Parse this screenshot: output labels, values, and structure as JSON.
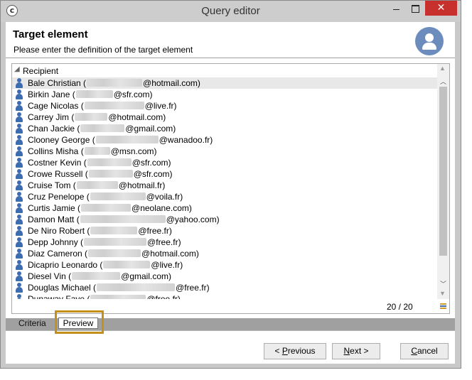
{
  "window": {
    "title": "Query editor",
    "app_icon_glyph": "c",
    "close_glyph": "✕"
  },
  "header": {
    "title": "Target element",
    "subtitle": "Please enter the definition of the target element"
  },
  "list": {
    "column_label": "Recipient",
    "rows": [
      {
        "name": "Bale Christian (",
        "email": "@hotmail.com)",
        "selected": true
      },
      {
        "name": "Birkin Jane (",
        "email": "@sfr.com)"
      },
      {
        "name": "Cage Nicolas (",
        "email": "@live.fr)"
      },
      {
        "name": "Carrey Jim (",
        "email": "@hotmail.com)"
      },
      {
        "name": "Chan Jackie (",
        "email": "@gmail.com)"
      },
      {
        "name": "Clooney George (",
        "email": "@wanadoo.fr)"
      },
      {
        "name": "Collins Misha (",
        "email": "@msn.com)"
      },
      {
        "name": "Costner Kevin (",
        "email": "@sfr.com)"
      },
      {
        "name": "Crowe Russell (",
        "email": "@sfr.com)"
      },
      {
        "name": "Cruise Tom (",
        "email": "@hotmail.fr)"
      },
      {
        "name": "Cruz Penelope (",
        "email": "@voila.fr)"
      },
      {
        "name": "Curtis Jamie (",
        "email": "@neolane.com)"
      },
      {
        "name": "Damon Matt (",
        "email": "@yahoo.com)"
      },
      {
        "name": "De Niro Robert (",
        "email": "@free.fr)"
      },
      {
        "name": "Depp Johnny (",
        "email": "@free.fr)"
      },
      {
        "name": "Diaz Cameron (",
        "email": "@hotmail.com)"
      },
      {
        "name": "Dicaprio Leonardo (",
        "email": "@live.fr)"
      },
      {
        "name": "Diesel Vin (",
        "email": "@gmail.com)"
      },
      {
        "name": "Douglas Michael (",
        "email": "@free.fr)"
      },
      {
        "name": "Dunaway Faye (",
        "email": "@free.fr)"
      }
    ],
    "count": "20 / 20"
  },
  "tabs": {
    "criteria": "Criteria",
    "preview": "Preview"
  },
  "buttons": {
    "previous": "< Previous",
    "next": "Next >",
    "cancel": "Cancel"
  },
  "colors": {
    "accent": "#6b8cbd",
    "highlight": "#c4901a",
    "close": "#c7302c"
  }
}
